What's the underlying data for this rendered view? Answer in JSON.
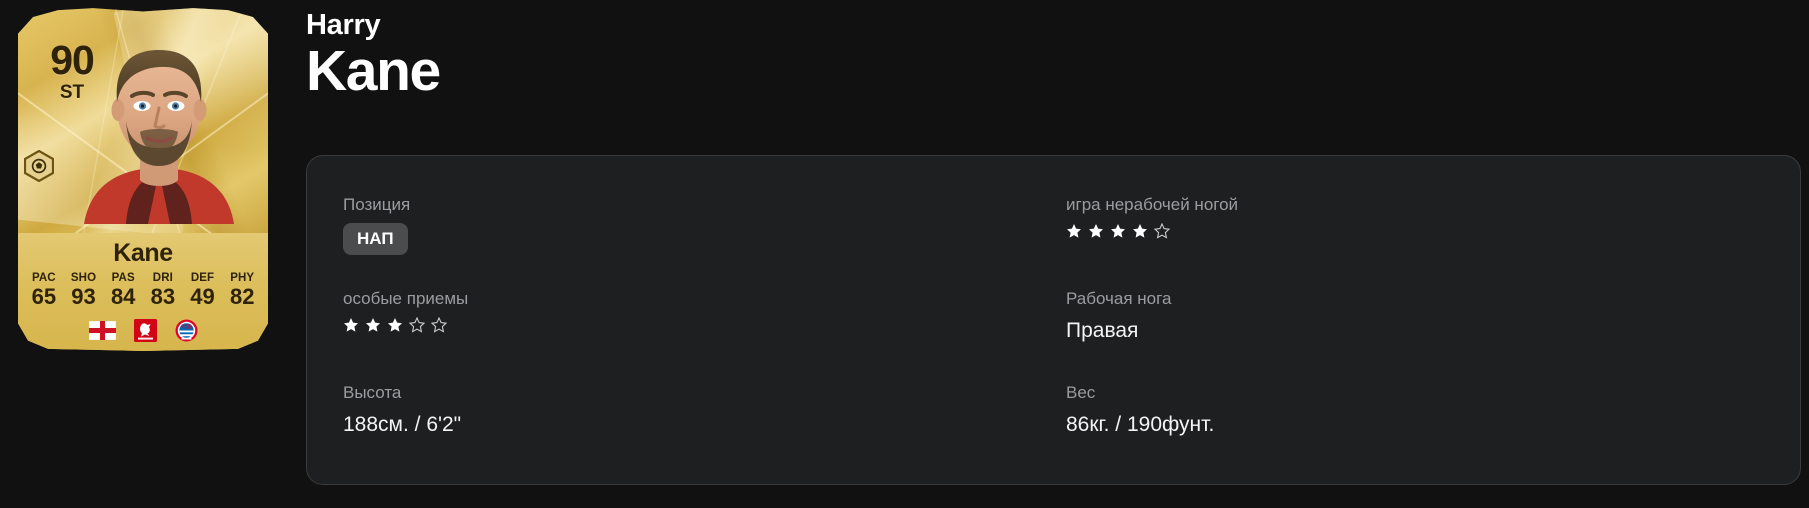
{
  "player": {
    "first_name": "Harry",
    "last_name": "Kane"
  },
  "card": {
    "rating": "90",
    "position_short": "ST",
    "surname": "Kane",
    "chemistry_icon": "chemistry-pentagon-icon",
    "stats": [
      {
        "key": "PAC",
        "value": "65"
      },
      {
        "key": "SHO",
        "value": "93"
      },
      {
        "key": "PAS",
        "value": "84"
      },
      {
        "key": "DRI",
        "value": "83"
      },
      {
        "key": "DEF",
        "value": "49"
      },
      {
        "key": "PHY",
        "value": "82"
      }
    ],
    "badges": [
      {
        "name": "nation-flag-england-icon"
      },
      {
        "name": "league-bundesliga-icon"
      },
      {
        "name": "club-bayern-munich-icon"
      }
    ],
    "colors": {
      "gold_light": "#f0dc9a",
      "gold_mid": "#dcbf5c",
      "gold_dark": "#c9a23b",
      "card_text": "#2e2208"
    }
  },
  "panel": {
    "fields": [
      {
        "label": "Позиция",
        "type": "chip",
        "value": "НАП"
      },
      {
        "label": "игра нерабочей ногой",
        "type": "stars",
        "filled": 4,
        "total": 5
      },
      {
        "label": "особые приемы",
        "type": "stars",
        "filled": 3,
        "total": 5
      },
      {
        "label": "Рабочая нога",
        "type": "text",
        "value": "Правая"
      },
      {
        "label": "Высота",
        "type": "text",
        "value": "188см. / 6'2\""
      },
      {
        "label": "Вес",
        "type": "text",
        "value": "86кг. / 190фунт."
      }
    ],
    "colors": {
      "background": "#1e1f20",
      "border": "#3a3c3d",
      "label": "#9a9d9f",
      "value": "#f2f4f5",
      "chip_bg": "#4a4c4e",
      "star": "#ffffff"
    }
  },
  "page": {
    "background": "#111111"
  }
}
